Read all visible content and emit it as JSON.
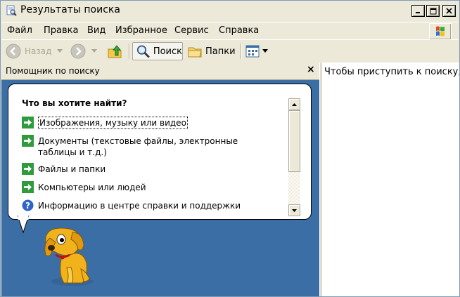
{
  "window": {
    "title": "Результаты поиска"
  },
  "menu": {
    "items": [
      "Файл",
      "Правка",
      "Вид",
      "Избранное",
      "Сервис",
      "Справка"
    ]
  },
  "toolbar": {
    "back_label": "Назад",
    "search_label": "Поиск",
    "folders_label": "Папки"
  },
  "left_pane": {
    "title": "Помощник по поиску",
    "close_glyph": "×",
    "prompt": "Что вы хотите найти?",
    "options": [
      {
        "label": "Изображения, музыку или видео",
        "icon": "green-arrow-icon"
      },
      {
        "label": "Документы (текстовые файлы, электронные таблицы и т.д.)",
        "icon": "green-arrow-icon"
      },
      {
        "label": "Файлы и папки",
        "icon": "green-arrow-icon"
      },
      {
        "label": "Компьютеры или людей",
        "icon": "green-arrow-icon"
      },
      {
        "label": "Информацию в центре справки и поддержки",
        "icon": "help-icon"
      }
    ]
  },
  "right_pane": {
    "text": "Чтобы приступить к поиску,"
  },
  "colors": {
    "pane_blue": "#3a6ea5",
    "arrow_green": "#2e9b3c"
  }
}
